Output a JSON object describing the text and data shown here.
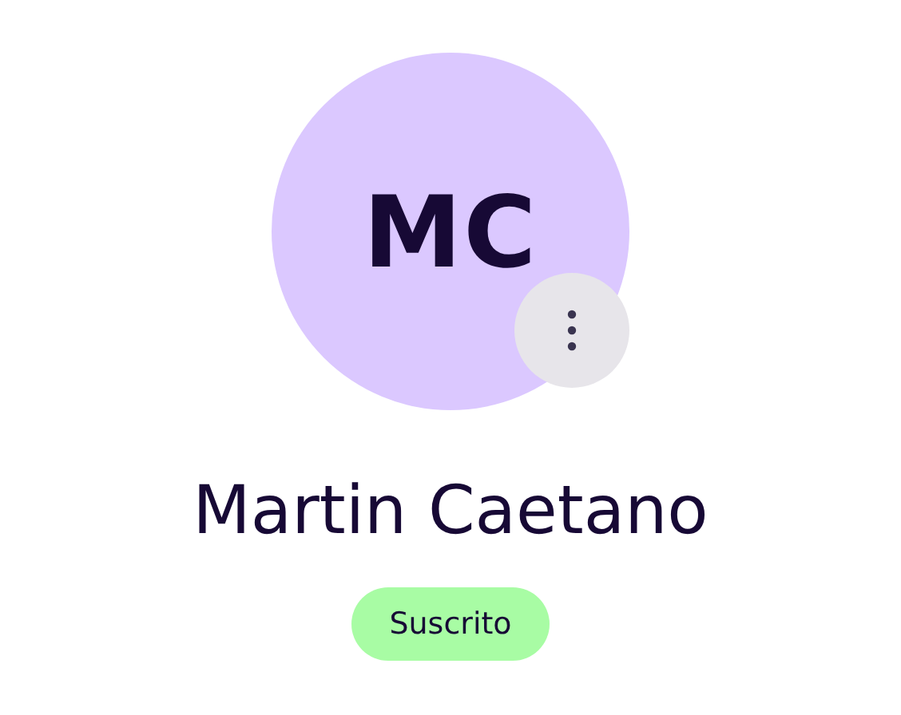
{
  "avatar": {
    "initials": "MC"
  },
  "profile": {
    "name": "Martin Caetano",
    "status": {
      "label": "Suscrito",
      "kind": "subscribed"
    }
  }
}
